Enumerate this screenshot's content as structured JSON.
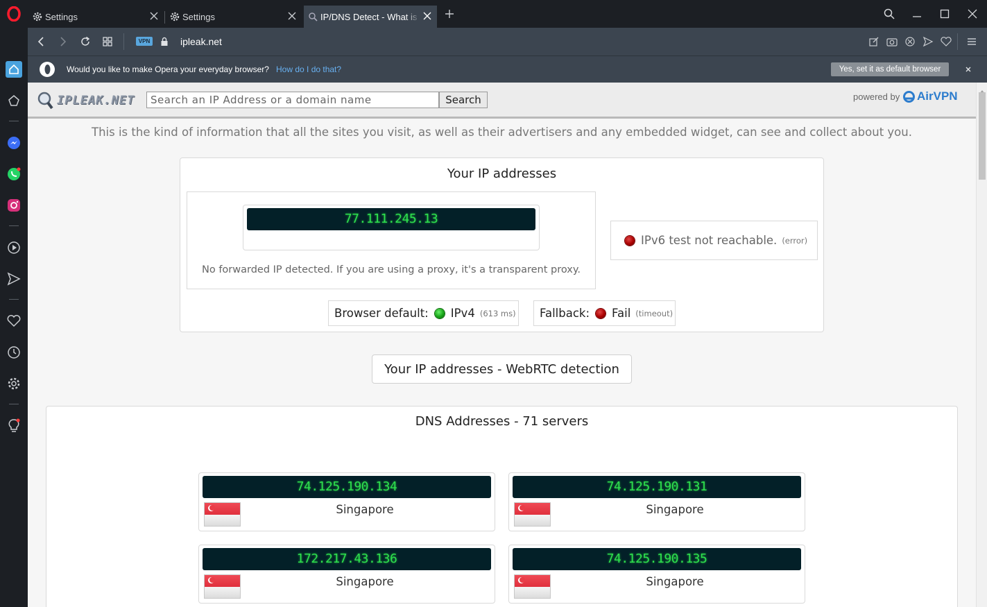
{
  "tabs": [
    {
      "title": "Settings",
      "icon": "gear-icon"
    },
    {
      "title": "Settings",
      "icon": "gear-icon"
    },
    {
      "title": "IP/DNS Detect - What is yo",
      "icon": "ipleak-favicon"
    }
  ],
  "address_bar": {
    "vpn_badge": "VPN",
    "url": "ipleak.net"
  },
  "banner": {
    "message": "Would you like to make Opera your everyday browser?",
    "link": "How do I do that?",
    "button": "Yes, set it as default browser"
  },
  "site": {
    "logo_text": "IPLEAK.NET",
    "search_placeholder": "Search an IP Address or a domain name",
    "search_button": "Search",
    "powered_by": "powered by",
    "sponsor": "AirVPN",
    "intro": "This is the kind of information that all the sites you visit, as well as their advertisers and any embedded widget, can see and collect about you."
  },
  "ip_section": {
    "title": "Your IP addresses",
    "ipv4": "77.111.245.13",
    "forward_note": "No forwarded IP detected. If you are using a proxy, it's a transparent proxy.",
    "ipv6_status": "IPv6 test not reachable.",
    "ipv6_detail": "(error)",
    "browser_default_label": "Browser default:",
    "browser_default_value": "IPv4",
    "browser_default_detail": "(613 ms)",
    "fallback_label": "Fallback:",
    "fallback_value": "Fail",
    "fallback_detail": "(timeout)"
  },
  "webrtc_button": "Your IP addresses - WebRTC detection",
  "dns_section": {
    "title": "DNS Addresses - 71 servers",
    "servers": [
      {
        "ip": "74.125.190.134",
        "country": "Singapore"
      },
      {
        "ip": "74.125.190.131",
        "country": "Singapore"
      },
      {
        "ip": "172.217.43.136",
        "country": "Singapore"
      },
      {
        "ip": "74.125.190.135",
        "country": "Singapore"
      }
    ]
  },
  "colors": {
    "lcd_bg": "#032028",
    "lcd_text": "#2ee04e",
    "opera_red": "#ff1b2d",
    "status_red": "#aa0000",
    "status_green": "#17a317"
  }
}
